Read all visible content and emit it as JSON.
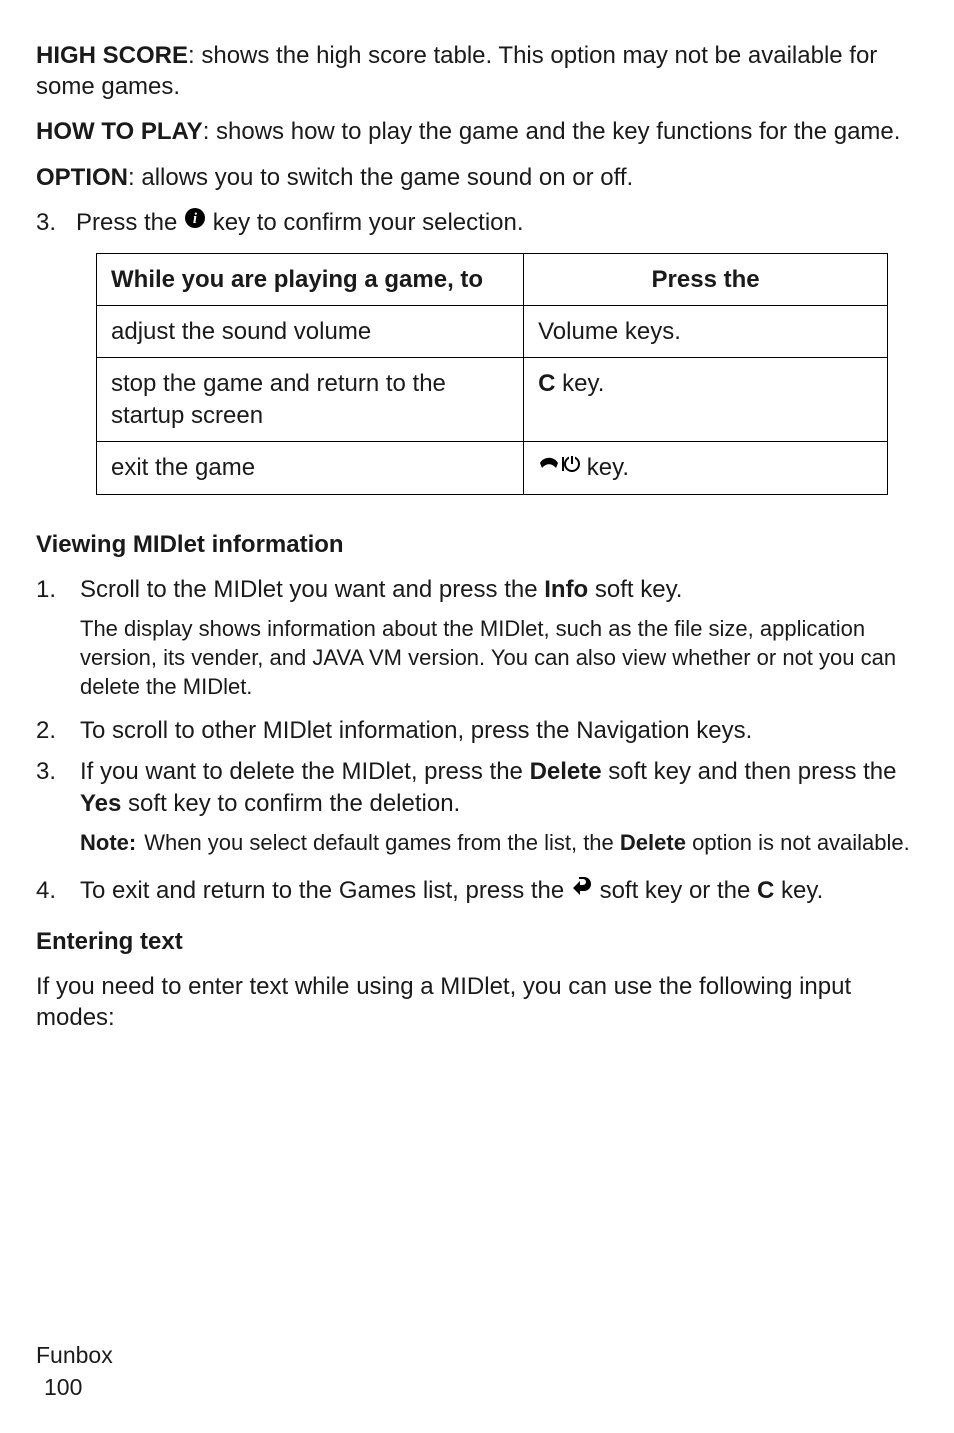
{
  "intro": {
    "hs_label": "HIGH SCORE",
    "hs_text": ": shows the high score table. This option may not be available for some games.",
    "htp_label": "HOW TO PLAY",
    "htp_text": ": shows how to play the game and the key functions for the game.",
    "opt_label": "OPTION",
    "opt_text": ": allows you to switch the game sound on or off."
  },
  "step3": {
    "num": "3.",
    "text_before": "Press the ",
    "text_after": " key to confirm your selection.",
    "icon_name": "confirm-icon"
  },
  "table": {
    "header_left": "While you are playing a game, to",
    "header_right": "Press the",
    "rows": [
      {
        "left": "adjust the sound volume",
        "right": "Volume keys."
      },
      {
        "left": "stop the game and return to the startup screen",
        "right_bold": "C",
        "right_rest": " key."
      },
      {
        "left": "exit the game",
        "right_icon": "end-power-icon",
        "right_after": " key."
      }
    ]
  },
  "midlet": {
    "heading": "Viewing MIDlet information",
    "s1": {
      "num": "1.",
      "text_before": "Scroll to the MIDlet you want and press the ",
      "bold": "Info",
      "text_after": " soft key."
    },
    "s1_detail": "The display shows information about the MIDlet, such as the file size, application version, its vender, and JAVA VM version. You can also view whether or not you can delete the MIDlet.",
    "s2": {
      "num": "2.",
      "text": "To scroll to other MIDlet information, press the Navigation keys."
    },
    "s3": {
      "num": "3.",
      "pre": "If you want to delete the MIDlet, press the ",
      "b1": "Delete",
      "mid": " soft key and then press the ",
      "b2": "Yes",
      "post": " soft key to confirm the deletion."
    },
    "note": {
      "label": "Note:",
      "pre": " When you select default games from the list, the ",
      "b": "Delete",
      "post": " option is not available."
    },
    "s4": {
      "num": "4.",
      "pre": "To exit and return to the Games list, press the ",
      "icon": "back-icon",
      "mid": " soft key or the ",
      "b": "C",
      "post": " key."
    }
  },
  "entering": {
    "heading": "Entering text",
    "body": "If you need to enter text while using a MIDlet, you can use the following input modes:"
  },
  "footer": {
    "section": "Funbox",
    "page": "100"
  }
}
